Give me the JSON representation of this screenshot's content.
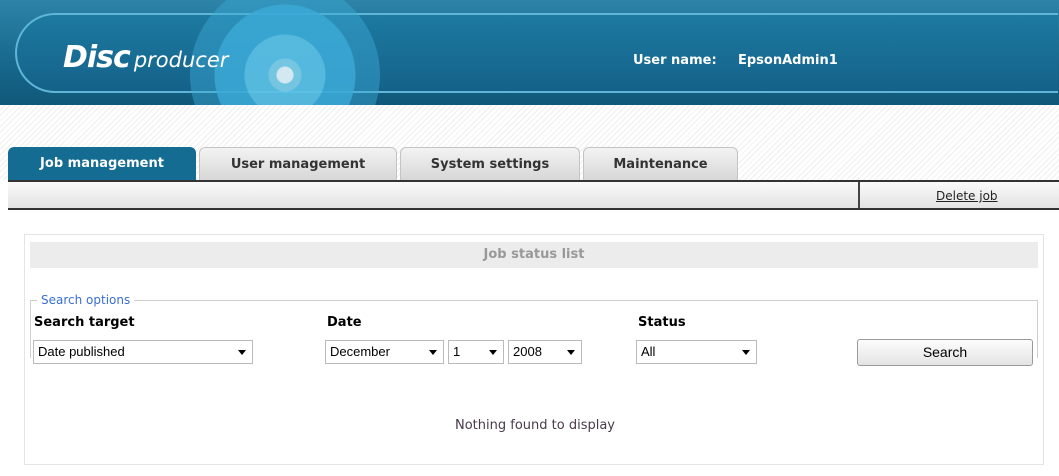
{
  "header": {
    "logo_disc": "Disc",
    "logo_producer": "producer",
    "user_label": "User name:",
    "user_value": "EpsonAdmin1"
  },
  "tabs": [
    {
      "label": "Job management",
      "active": true
    },
    {
      "label": "User management",
      "active": false
    },
    {
      "label": "System settings",
      "active": false
    },
    {
      "label": "Maintenance",
      "active": false
    }
  ],
  "toolbar": {
    "delete_job": "Delete job"
  },
  "panel": {
    "title": "Job status list",
    "search_options_legend": "Search options",
    "search_target": {
      "label": "Search target",
      "value": "Date published"
    },
    "date": {
      "label": "Date",
      "month": "December",
      "day": "1",
      "year": "2008"
    },
    "status": {
      "label": "Status",
      "value": "All"
    },
    "search_button": "Search",
    "empty_message": "Nothing found to display"
  },
  "colors": {
    "header_blue": "#156c92",
    "legend_blue": "#3a6fd0"
  }
}
